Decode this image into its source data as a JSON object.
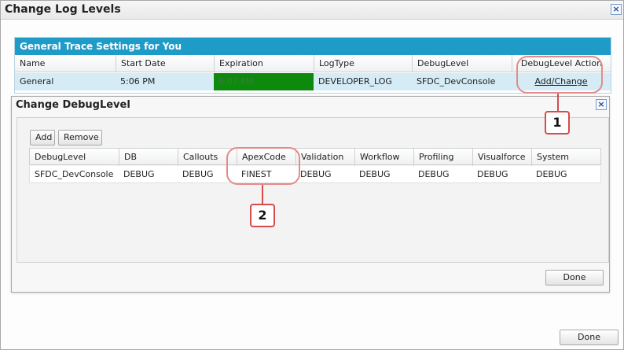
{
  "window": {
    "title": "Change Log Levels",
    "done_label": "Done"
  },
  "trace": {
    "header": "General Trace Settings for You",
    "columns": [
      "Name",
      "Start Date",
      "Expiration",
      "LogType",
      "DebugLevel",
      "DebugLevel Action"
    ],
    "row": {
      "name": "General",
      "start_date": "5:06 PM",
      "expiration": "6:07 PM",
      "log_type": "DEVELOPER_LOG",
      "debug_level": "SFDC_DevConsole",
      "action": "Add/Change"
    },
    "expiration_color": "#0d8a0d",
    "header_color": "#1f9bc8"
  },
  "dialog": {
    "title": "Change DebugLevel",
    "add_label": "Add",
    "remove_label": "Remove",
    "done_label": "Done",
    "columns": [
      "DebugLevel",
      "DB",
      "Callouts",
      "ApexCode",
      "Validation",
      "Workflow",
      "Profiling",
      "Visualforce",
      "System"
    ],
    "row": [
      "SFDC_DevConsole",
      "DEBUG",
      "DEBUG",
      "FINEST",
      "DEBUG",
      "DEBUG",
      "DEBUG",
      "DEBUG",
      "DEBUG"
    ]
  },
  "callouts": [
    {
      "label": "1",
      "color": "#d34d4d"
    },
    {
      "label": "2",
      "color": "#d34d4d"
    }
  ]
}
